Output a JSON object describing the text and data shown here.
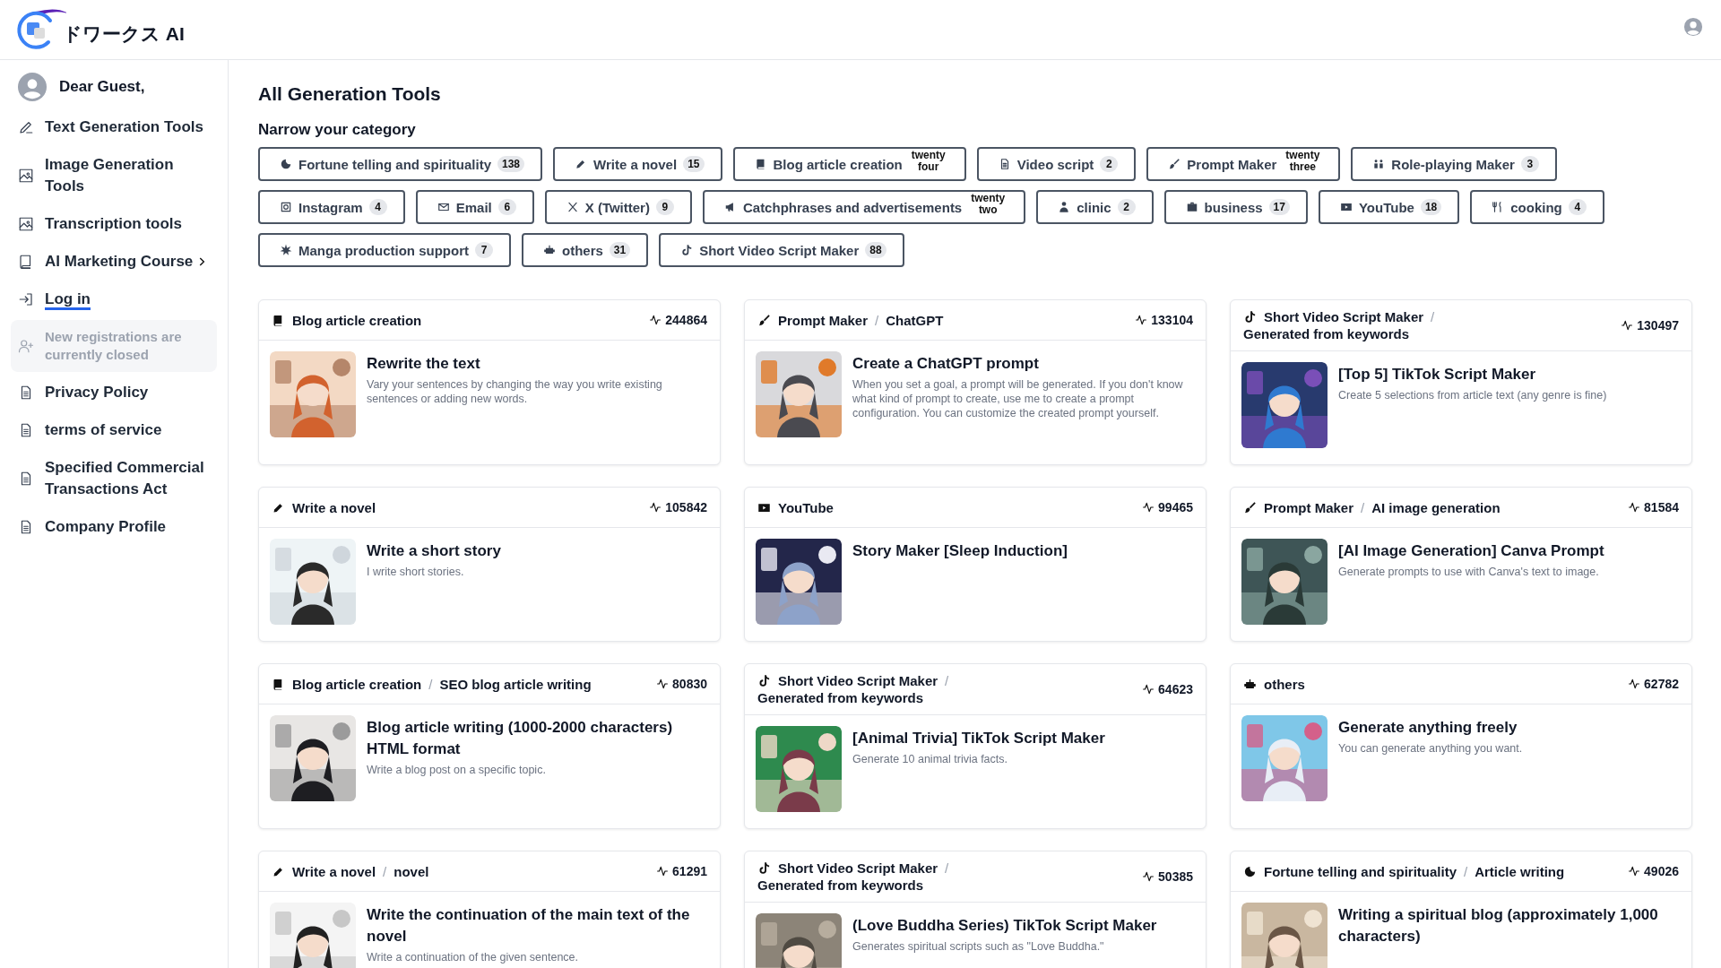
{
  "header": {
    "logo_text": "ドワークス AI"
  },
  "sidebar": {
    "greeting": "Dear Guest,",
    "items": [
      {
        "label": "Text Generation Tools",
        "kind": "nav"
      },
      {
        "label": "Image Generation Tools",
        "kind": "nav"
      },
      {
        "label": "Transcription tools",
        "kind": "nav"
      },
      {
        "label": "AI Marketing Course",
        "kind": "submenu"
      },
      {
        "label": "Log in",
        "kind": "link"
      },
      {
        "label": "New registrations are currently closed",
        "kind": "disabled"
      },
      {
        "label": "Privacy Policy",
        "kind": "nav"
      },
      {
        "label": "terms of service",
        "kind": "nav"
      },
      {
        "label": "Specified Commercial Transactions Act",
        "kind": "nav"
      },
      {
        "label": "Company Profile",
        "kind": "nav"
      }
    ]
  },
  "main": {
    "title": "All Generation Tools",
    "filter_heading": "Narrow your category",
    "categories": [
      {
        "label": "Fortune telling and spirituality",
        "count": "138",
        "kind": "number"
      },
      {
        "label": "Write a novel",
        "count": "15",
        "kind": "number"
      },
      {
        "label": "Blog article creation",
        "count": "twenty four",
        "kind": "words"
      },
      {
        "label": "Video script",
        "count": "2",
        "kind": "number"
      },
      {
        "label": "Prompt Maker",
        "count": "twenty three",
        "kind": "words"
      },
      {
        "label": "Role-playing Maker",
        "count": "3",
        "kind": "number"
      },
      {
        "label": "Instagram",
        "count": "4",
        "kind": "number"
      },
      {
        "label": "Email",
        "count": "6",
        "kind": "number"
      },
      {
        "label": "X (Twitter)",
        "count": "9",
        "kind": "number"
      },
      {
        "label": "Catchphrases and advertisements",
        "count": "twenty two",
        "kind": "words"
      },
      {
        "label": "clinic",
        "count": "2",
        "kind": "number"
      },
      {
        "label": "business",
        "count": "17",
        "kind": "number"
      },
      {
        "label": "YouTube",
        "count": "18",
        "kind": "number"
      },
      {
        "label": "cooking",
        "count": "4",
        "kind": "number"
      },
      {
        "label": "Manga production support",
        "count": "7",
        "kind": "number"
      },
      {
        "label": "others",
        "count": "31",
        "kind": "number"
      },
      {
        "label": "Short Video Script Maker",
        "count": "88",
        "kind": "number"
      }
    ],
    "cards": [
      {
        "crumbs": [
          "Blog article creation"
        ],
        "views": "244864",
        "title": "Rewrite the text",
        "description": "Vary your sentences by changing the way you write existing sentences or adding new words."
      },
      {
        "crumbs": [
          "Prompt Maker",
          "ChatGPT"
        ],
        "separator": "/",
        "views": "133104",
        "title": "Create a ChatGPT prompt",
        "description": "When you set a goal, a prompt will be generated. If you don't know what kind of prompt to create, use me to create a prompt configuration. You can customize the created prompt yourself."
      },
      {
        "crumbs": [
          "Short Video Script Maker",
          "Generated from keywords"
        ],
        "separator": "/",
        "views": "130497",
        "title": "[Top 5] TikTok Script Maker",
        "description": "Create 5 selections from article text (any genre is fine)"
      },
      {
        "crumbs": [
          "Write a novel"
        ],
        "views": "105842",
        "title": "Write a short story",
        "description": "I write short stories."
      },
      {
        "crumbs": [
          "YouTube"
        ],
        "views": "99465",
        "title": "Story Maker [Sleep Induction]"
      },
      {
        "crumbs": [
          "Prompt Maker",
          "AI image generation"
        ],
        "separator": "/",
        "views": "81584",
        "title": "[AI Image Generation] Canva Prompt",
        "description": "Generate prompts to use with Canva's text to image."
      },
      {
        "crumbs": [
          "Blog article creation",
          "SEO blog article writing"
        ],
        "separator": "/",
        "views": "80830",
        "title": "Blog article writing (1000-2000 characters) HTML format",
        "description": "Write a blog post on a specific topic."
      },
      {
        "crumbs": [
          "Short Video Script Maker",
          "Generated from keywords"
        ],
        "separator": "/",
        "views": "64623",
        "title": "[Animal Trivia] TikTok Script Maker",
        "description": "Generate 10 animal trivia facts."
      },
      {
        "crumbs": [
          "others"
        ],
        "views": "62782",
        "title": "Generate anything freely",
        "description": "You can generate anything you want."
      },
      {
        "crumbs": [
          "Write a novel",
          "novel"
        ],
        "separator": "/",
        "views": "61291",
        "title": "Write the continuation of the main text of the novel",
        "description": "Write a continuation of the given sentence."
      },
      {
        "crumbs": [
          "Short Video Script Maker",
          "Generated from keywords"
        ],
        "separator": "/",
        "views": "50385",
        "title": "(Love Buddha Series) TikTok Script Maker",
        "description": "Generates spiritual scripts such as \"Love Buddha.\""
      },
      {
        "crumbs": [
          "Fortune telling and spirituality",
          "Article writing"
        ],
        "separator": "/",
        "views": "49026",
        "title": "Writing a spiritual blog (approximately 1,000 characters)"
      }
    ]
  }
}
